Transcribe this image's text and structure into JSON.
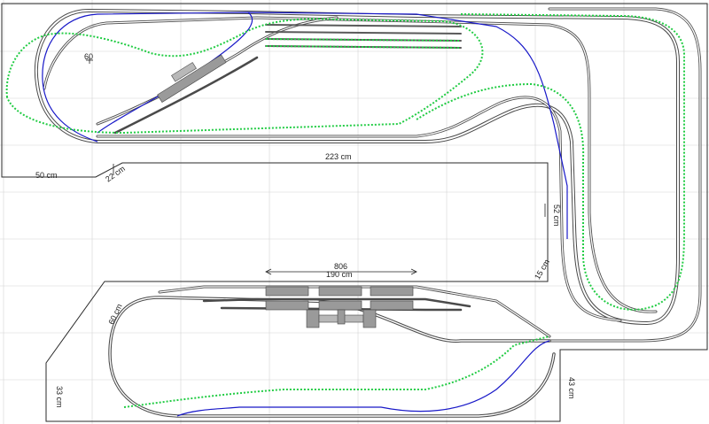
{
  "labels": {
    "num_60": "60",
    "dim_223": "223 cm",
    "dim_50": "50 cm",
    "dim_22": "22 cm",
    "dim_52": "52 cm",
    "dim_15": "15 cm",
    "dim_806": "806",
    "dim_190": "190 cm",
    "dim_60b": "60 cm",
    "dim_33": "33 cm",
    "dim_43": "43 cm"
  },
  "colors": {
    "grid": "#d4d4d4",
    "board": "#2a2a2a",
    "track_outer": "#4a4a4a",
    "track_inner": "#8a8a8a",
    "blue_track": "#1818c8",
    "green_track": "#22cc44",
    "building": "#9a9a9a",
    "platform": "#b8b8b8"
  }
}
